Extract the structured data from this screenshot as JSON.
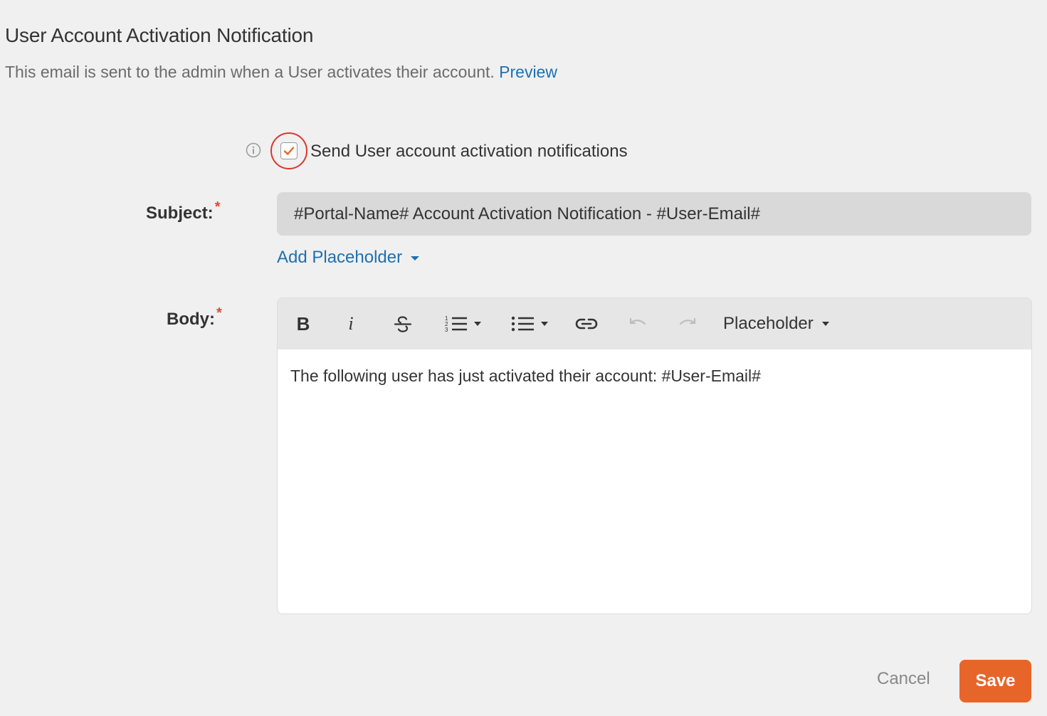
{
  "header": {
    "title": "User Account Activation Notification",
    "description": "This email is sent to the admin when a User activates their account.",
    "preview_link": "Preview"
  },
  "activation": {
    "checkbox_label": "Send User account activation notifications",
    "checked": true,
    "info_icon": "info-icon"
  },
  "subject": {
    "label": "Subject:",
    "required_mark": "*",
    "value": "#Portal-Name# Account Activation Notification - #User-Email#",
    "add_placeholder": "Add Placeholder"
  },
  "body": {
    "label": "Body:",
    "required_mark": "*",
    "toolbar": {
      "bold": "B",
      "italic": "i",
      "placeholder_dropdown": "Placeholder"
    },
    "content": "The following user has just activated their account: #User-Email#"
  },
  "footer": {
    "cancel": "Cancel",
    "save": "Save"
  },
  "colors": {
    "accent": "#e8652a",
    "link": "#1f70b0",
    "highlight_circle": "#d9382c"
  }
}
